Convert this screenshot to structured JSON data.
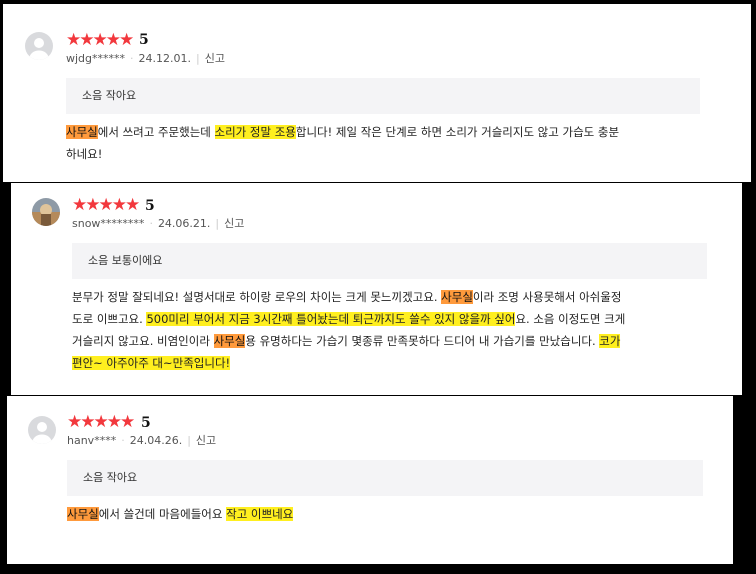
{
  "colors": {
    "star": "#f2383d",
    "highlight_orange": "#ff9a3c",
    "highlight_yellow": "#ffef1f"
  },
  "reviews": [
    {
      "stars": "★★★★★",
      "score": "5",
      "user": "wjdg******",
      "date": "24.12.01.",
      "report": "신고",
      "option": "소음 작아요",
      "text": {
        "a1": "사무실",
        "a2": "에서 쓰려고 주문했는데 ",
        "a3": "소리가 정말 조용",
        "a4": "합니다! 제일 작은 단계로 하면 소리가 거슬리지도 않고 가습도 충분",
        "b1": "하네요!"
      }
    },
    {
      "stars": "★★★★★",
      "score": "5",
      "user": "snow********",
      "date": "24.06.21.",
      "report": "신고",
      "option": "소음 보통이에요",
      "text": {
        "a1": "분무가 정말 잘되네요! 설명서대로 하이랑 로우의 차이는 크게 못느끼겠고요. ",
        "a2": "사무실",
        "a3": "이라 조명 사용못해서 아쉬울정",
        "b1": "도로 이쁘고요. ",
        "b2": "500미리 부어서 지금 3시간째 틀어놨는데 퇴근까지도 쓸수 있지 않을까 싶어",
        "b3": "요. 소음 이정도면 크게",
        "c1": "거슬리지 않고요. 비염인이라 ",
        "c2": "사무실",
        "c3": "용 유명하다는 가습기 몇종류 만족못하다 드디어 내 가습기를 만났습니다. ",
        "c4": "코가",
        "d1": "편안~ 아주아주 대~만족입니다!"
      }
    },
    {
      "stars": "★★★★★",
      "score": "5",
      "user": "hanv****",
      "date": "24.04.26.",
      "report": "신고",
      "option": "소음 작아요",
      "text": {
        "a1": "사무실",
        "a2": "에서 쓸건데 마음에들어요 ",
        "a3": "작고 이쁘네요"
      }
    }
  ]
}
